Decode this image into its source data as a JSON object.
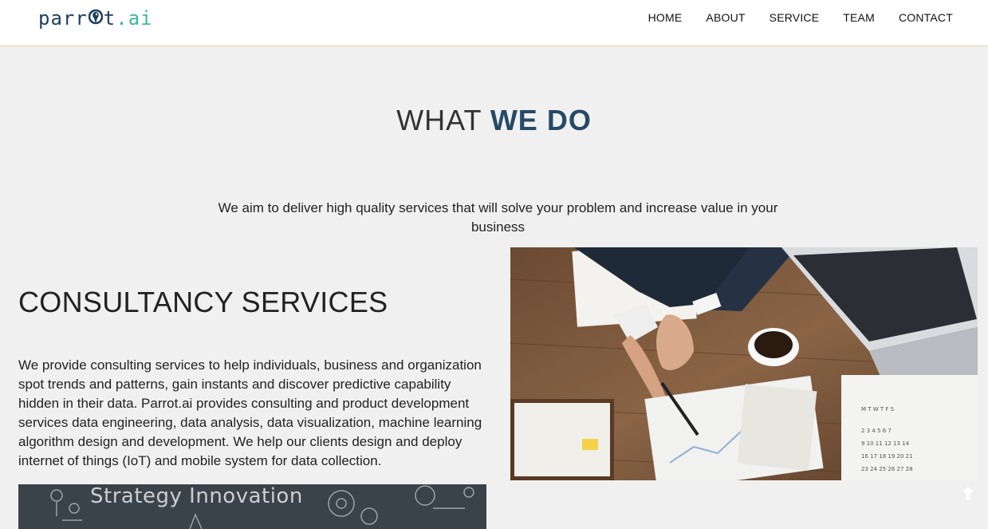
{
  "header": {
    "logo": {
      "part_a": "parr",
      "part_mid": "t",
      "part_b": ".ai"
    },
    "nav": [
      "HOME",
      "ABOUT",
      "SERVICE",
      "TEAM",
      "CONTACT"
    ]
  },
  "section": {
    "title_light": "WHAT ",
    "title_strong": "WE DO",
    "subtitle": "We aim to deliver high quality services that will solve your problem and increase value in your business"
  },
  "service": {
    "title": "CONSULTANCY SERVICES",
    "description": "We provide consulting services to help individuals, business and organization spot trends and patterns, gain instants and discover predictive capability hidden in their data. Parrot.ai provides consulting and product development services data engineering, data analysis, data visualization, machine learning algorithm design and development. We help our clients design and deploy internet of things (IoT) and mobile system for data collection."
  },
  "images": {
    "strategy_board_text": "Strategy Innovation"
  },
  "colors": {
    "brand_dark": "#1e3f5c",
    "brand_green": "#3bb89a",
    "title_accent": "#264a66",
    "background": "#f0f0f0"
  },
  "icons": {
    "scroll_top": "arrow-up-icon",
    "logo_mark": "parrot-head-icon"
  }
}
